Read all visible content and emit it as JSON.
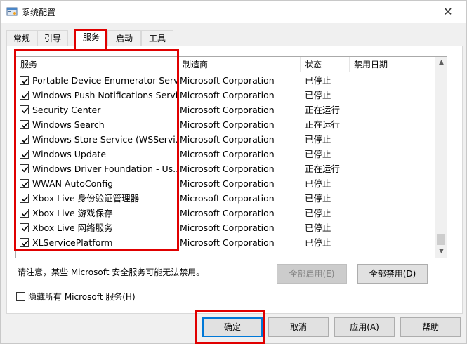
{
  "window": {
    "title": "系统配置",
    "close_symbol": "✕"
  },
  "tabs": [
    {
      "label": "常规",
      "active": false
    },
    {
      "label": "引导",
      "active": false
    },
    {
      "label": "服务",
      "active": true
    },
    {
      "label": "启动",
      "active": false
    },
    {
      "label": "工具",
      "active": false
    }
  ],
  "table": {
    "columns": [
      "服务",
      "制造商",
      "状态",
      "禁用日期"
    ],
    "rows": [
      {
        "service": "Portable Device Enumerator Serv...",
        "manufacturer": "Microsoft Corporation",
        "status": "已停止",
        "disabled_date": "",
        "checked": true
      },
      {
        "service": "Windows Push Notifications Servi...",
        "manufacturer": "Microsoft Corporation",
        "status": "已停止",
        "disabled_date": "",
        "checked": true
      },
      {
        "service": "Security Center",
        "manufacturer": "Microsoft Corporation",
        "status": "正在运行",
        "disabled_date": "",
        "checked": true
      },
      {
        "service": "Windows Search",
        "manufacturer": "Microsoft Corporation",
        "status": "正在运行",
        "disabled_date": "",
        "checked": true
      },
      {
        "service": "Windows Store Service (WSServi...",
        "manufacturer": "Microsoft Corporation",
        "status": "已停止",
        "disabled_date": "",
        "checked": true
      },
      {
        "service": "Windows Update",
        "manufacturer": "Microsoft Corporation",
        "status": "已停止",
        "disabled_date": "",
        "checked": true
      },
      {
        "service": "Windows Driver Foundation - Us...",
        "manufacturer": "Microsoft Corporation",
        "status": "正在运行",
        "disabled_date": "",
        "checked": true
      },
      {
        "service": "WWAN AutoConfig",
        "manufacturer": "Microsoft Corporation",
        "status": "已停止",
        "disabled_date": "",
        "checked": true
      },
      {
        "service": "Xbox Live 身份验证管理器",
        "manufacturer": "Microsoft Corporation",
        "status": "已停止",
        "disabled_date": "",
        "checked": true
      },
      {
        "service": "Xbox Live 游戏保存",
        "manufacturer": "Microsoft Corporation",
        "status": "已停止",
        "disabled_date": "",
        "checked": true
      },
      {
        "service": "Xbox Live 网络服务",
        "manufacturer": "Microsoft Corporation",
        "status": "已停止",
        "disabled_date": "",
        "checked": true
      },
      {
        "service": "XLServicePlatform",
        "manufacturer": "Microsoft Corporation",
        "status": "已停止",
        "disabled_date": "",
        "checked": true
      }
    ]
  },
  "note": "请注意，某些 Microsoft 安全服务可能无法禁用。",
  "buttons": {
    "enable_all": "全部启用(E)",
    "disable_all": "全部禁用(D)",
    "ok": "确定",
    "cancel": "取消",
    "apply": "应用(A)",
    "help": "帮助"
  },
  "hide_ms": {
    "label": "隐藏所有 Microsoft 服务(H)",
    "checked": false
  },
  "colors": {
    "highlight": "#e00000",
    "accent": "#0078d7"
  }
}
